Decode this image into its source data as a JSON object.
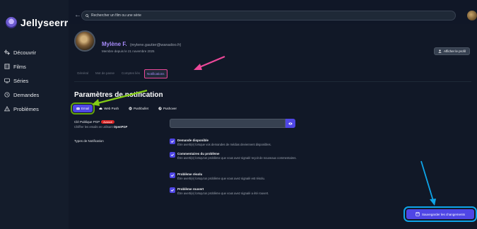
{
  "app": {
    "name": "Jellyseerr"
  },
  "sidebar": {
    "items": [
      {
        "label": "Découvrir",
        "icon": "sparkles-icon"
      },
      {
        "label": "Films",
        "icon": "film-icon"
      },
      {
        "label": "Séries",
        "icon": "tv-icon"
      },
      {
        "label": "Demandes",
        "icon": "clock-icon"
      },
      {
        "label": "Problèmes",
        "icon": "warning-icon"
      }
    ]
  },
  "search": {
    "placeholder": "Rechercher un film ou une série"
  },
  "profile": {
    "name": "Mylène F.",
    "email": "(mylene.gautier@wanadoo.fr)",
    "since": "Membre depuis le 21 novembre 2025",
    "view_profile": "Afficher le profil"
  },
  "tabs": [
    {
      "label": "Général",
      "active": false
    },
    {
      "label": "Mot de passe",
      "active": false
    },
    {
      "label": "Comptes liés",
      "active": false
    },
    {
      "label": "Notifications",
      "active": true
    }
  ],
  "notifications": {
    "title": "Paramètres de notification",
    "agents": [
      {
        "label": "Email",
        "icon": "mail-icon",
        "active": true
      },
      {
        "label": "Web Push",
        "icon": "cloud-icon",
        "active": false
      },
      {
        "label": "Pushbullet",
        "icon": "pushbullet-icon",
        "active": false
      },
      {
        "label": "Pushover",
        "icon": "pushover-icon",
        "active": false
      }
    ],
    "pgp": {
      "label": "Clé Publique PGP",
      "badge": "Avancé",
      "hint": "Chiffrer les emails en utilisant",
      "hint_link": "OpenPGP"
    },
    "types_label": "Types de Notification",
    "types": [
      {
        "title": "Demande disponible",
        "desc": "Être averti(e) lorsque vos demandes de médias deviennent disponibles.",
        "checked": true
      },
      {
        "title": "Commentaires du problème",
        "desc": "Être averti(e) lorsqu'un problème que vous avez signalé reçoit de nouveaux commentaires.",
        "checked": true
      },
      {
        "title": "Problème résolu",
        "desc": "Être averti(e) lorsqu'un problème que vous avez signalé est résolu.",
        "checked": true
      },
      {
        "title": "Problème rouvert",
        "desc": "Être averti(e) lorsqu'un problème que vous avez signalé a été rouvert.",
        "checked": true
      }
    ]
  },
  "save_button": {
    "label": "Sauvegarder les changements"
  },
  "colors": {
    "accent": "#4f46e5",
    "purple": "#a78bfa",
    "pink_annotation": "#ec4899",
    "green_annotation": "#65a30d",
    "blue_annotation": "#0ea5e9"
  }
}
